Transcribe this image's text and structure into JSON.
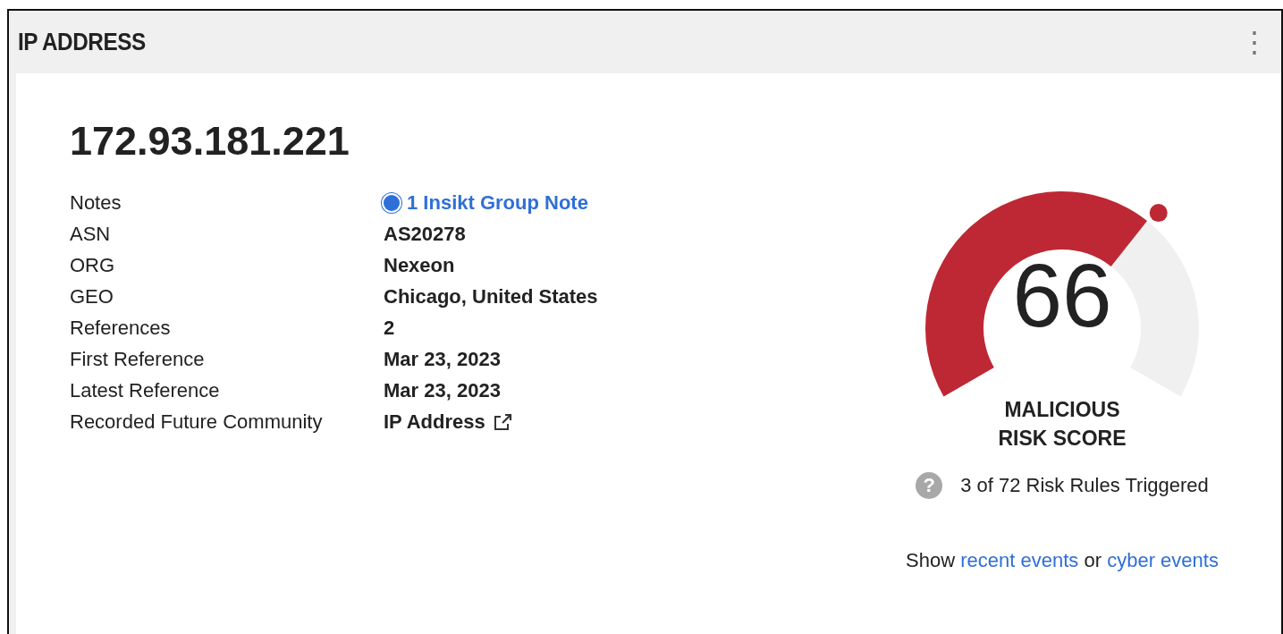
{
  "panel": {
    "title": "IP ADDRESS",
    "menu_icon": "⋮"
  },
  "ip": "172.93.181.221",
  "details": [
    {
      "label": "Notes",
      "value": "1 Insikt Group Note",
      "kind": "note-link"
    },
    {
      "label": "ASN",
      "value": "AS20278",
      "kind": "text"
    },
    {
      "label": "ORG",
      "value": "Nexeon",
      "kind": "text"
    },
    {
      "label": "GEO",
      "value": "Chicago, United States",
      "kind": "text"
    },
    {
      "label": "References",
      "value": "2",
      "kind": "text"
    },
    {
      "label": "First Reference",
      "value": "Mar 23, 2023",
      "kind": "text"
    },
    {
      "label": "Latest Reference",
      "value": "Mar 23, 2023",
      "kind": "text"
    },
    {
      "label": "Recorded Future Community",
      "value": "IP Address",
      "kind": "external"
    }
  ],
  "risk": {
    "score": "66",
    "color": "#bd2834",
    "label_lines": [
      "MALICIOUS",
      "RISK SCORE"
    ],
    "help_icon": "?",
    "rules": "3 of 72 Risk Rules Triggered"
  },
  "events": {
    "prefix": "Show",
    "links": [
      "recent events",
      "cyber events"
    ],
    "joiner": "or"
  }
}
